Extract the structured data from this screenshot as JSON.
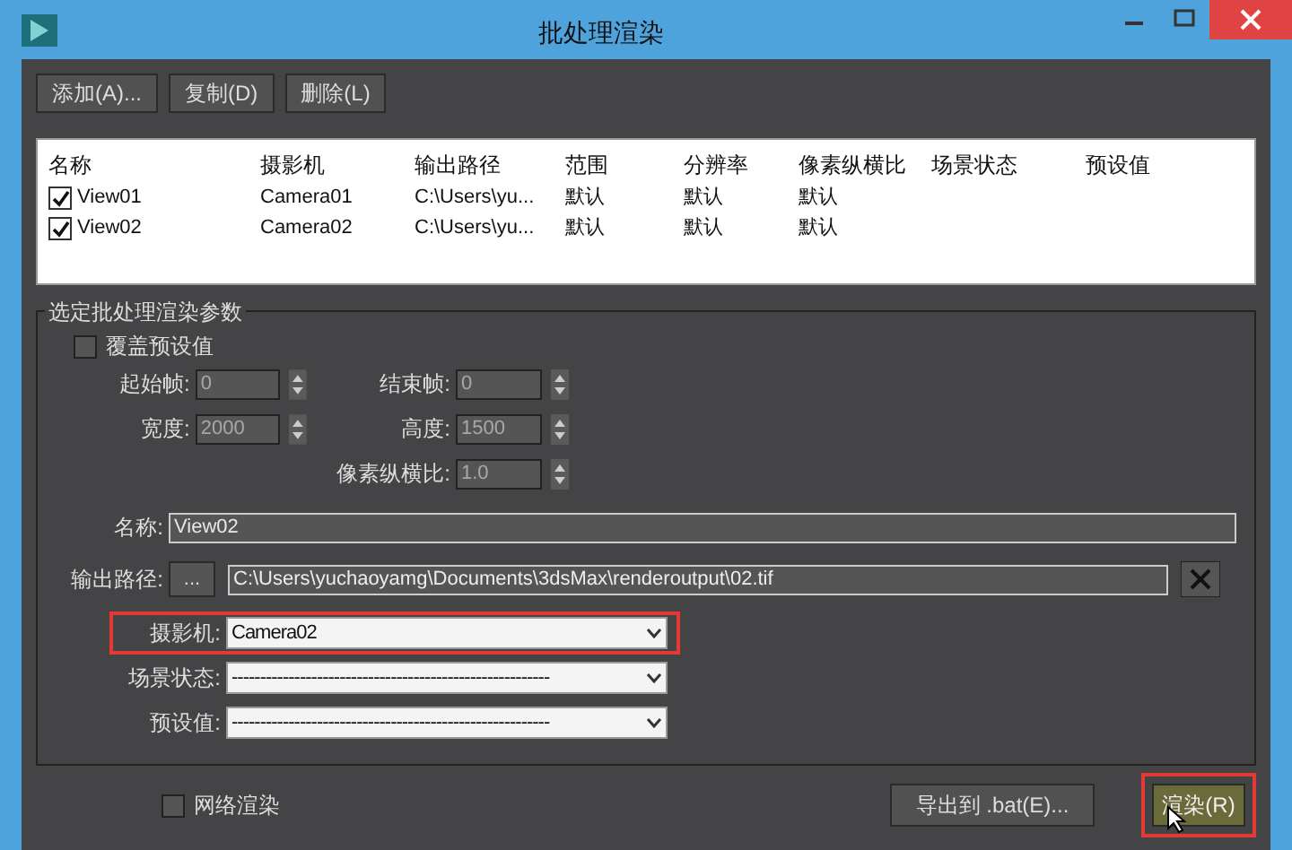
{
  "window": {
    "title": "批处理渲染"
  },
  "toolbar": [
    {
      "label": "添加(A)..."
    },
    {
      "label": "复制(D)"
    },
    {
      "label": "删除(L)"
    }
  ],
  "list": {
    "columns": [
      "名称",
      "摄影机",
      "输出路径",
      "范围",
      "分辨率",
      "像素纵横比",
      "场景状态",
      "预设值"
    ],
    "rows": [
      {
        "checked": true,
        "name": "View01",
        "camera": "Camera01",
        "output_path": "C:\\Users\\yu...",
        "range": "默认",
        "resolution": "默认",
        "pixel_aspect": "默认"
      },
      {
        "checked": true,
        "name": "View02",
        "camera": "Camera02",
        "output_path": "C:\\Users\\yu...",
        "range": "默认",
        "resolution": "默认",
        "pixel_aspect": "默认"
      }
    ]
  },
  "params": {
    "title": "选定批处理渲染参数",
    "override": {
      "label": "覆盖预设值",
      "checked": false
    },
    "spinner_rows": [
      {
        "left": {
          "label": "起始帧:",
          "value": "0"
        },
        "right": {
          "label": "结束帧:",
          "value": "0"
        }
      },
      {
        "left": {
          "label": "宽度:",
          "value": "2000"
        },
        "right": {
          "label": "高度:",
          "value": "1500"
        }
      },
      {
        "right": {
          "label": "像素纵横比:",
          "value": "1.0"
        }
      }
    ],
    "name": {
      "label": "名称:",
      "value": "View02"
    },
    "output": {
      "label": "输出路径:",
      "browse": "...",
      "value": "C:\\Users\\yuchaoyamg\\Documents\\3dsMax\\renderoutput\\02.tif"
    },
    "camera": {
      "label": "摄影机:",
      "value": "Camera02",
      "highlighted": true
    },
    "scene_state": {
      "label": "场景状态:",
      "value": "--------------------------------------------------------",
      "highlighted": false
    },
    "preset": {
      "label": "预设值:",
      "value": "--------------------------------------------------------",
      "highlighted": false
    }
  },
  "footer": {
    "network": {
      "label": "网络渲染",
      "checked": false
    },
    "export": "导出到 .bat(E)...",
    "render": {
      "label": "渲染(R)",
      "highlighted": true
    }
  }
}
